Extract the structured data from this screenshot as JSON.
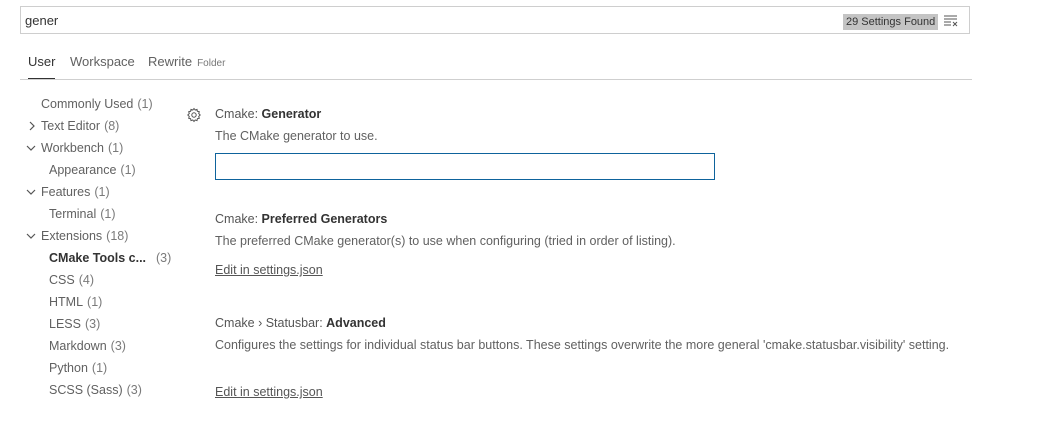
{
  "search": {
    "value": "gener",
    "result_count": "29 Settings Found",
    "clear_icon": "clear-filter-icon"
  },
  "tabs": [
    {
      "label": "User",
      "active": true
    },
    {
      "label": "Workspace",
      "active": false
    },
    {
      "label": "Rewrite",
      "hint": "Folder",
      "active": false
    }
  ],
  "tree": {
    "commonly_used": {
      "label": "Commonly Used",
      "count": "(1)"
    },
    "text_editor": {
      "label": "Text Editor",
      "count": "(8)"
    },
    "workbench": {
      "label": "Workbench",
      "count": "(1)"
    },
    "appearance": {
      "label": "Appearance",
      "count": "(1)"
    },
    "features": {
      "label": "Features",
      "count": "(1)"
    },
    "terminal": {
      "label": "Terminal",
      "count": "(1)"
    },
    "extensions": {
      "label": "Extensions",
      "count": "(18)"
    },
    "cmake_tools": {
      "label": "CMake Tools c...",
      "count": "(3)"
    },
    "css": {
      "label": "CSS",
      "count": "(4)"
    },
    "html": {
      "label": "HTML",
      "count": "(1)"
    },
    "less": {
      "label": "LESS",
      "count": "(3)"
    },
    "markdown": {
      "label": "Markdown",
      "count": "(3)"
    },
    "python": {
      "label": "Python",
      "count": "(1)"
    },
    "scss": {
      "label": "SCSS (Sass)",
      "count": "(3)"
    }
  },
  "settings": {
    "generator": {
      "category": "Cmake: ",
      "name": "Generator",
      "description": "The CMake generator to use.",
      "value": ""
    },
    "preferred_generators": {
      "category": "Cmake: ",
      "name": "Preferred Generators",
      "description": "The preferred CMake generator(s) to use when configuring (tried in order of listing).",
      "link": "Edit in settings.json"
    },
    "statusbar_advanced": {
      "category": "Cmake › Statusbar: ",
      "name": "Advanced",
      "description": "Configures the settings for individual status bar buttons. These settings overwrite the more general 'cmake.statusbar.visibility' setting.",
      "link": "Edit in settings.json"
    }
  },
  "colors": {
    "input_border_focus": "#0e639c",
    "badge_bg": "#c4c4c4"
  }
}
